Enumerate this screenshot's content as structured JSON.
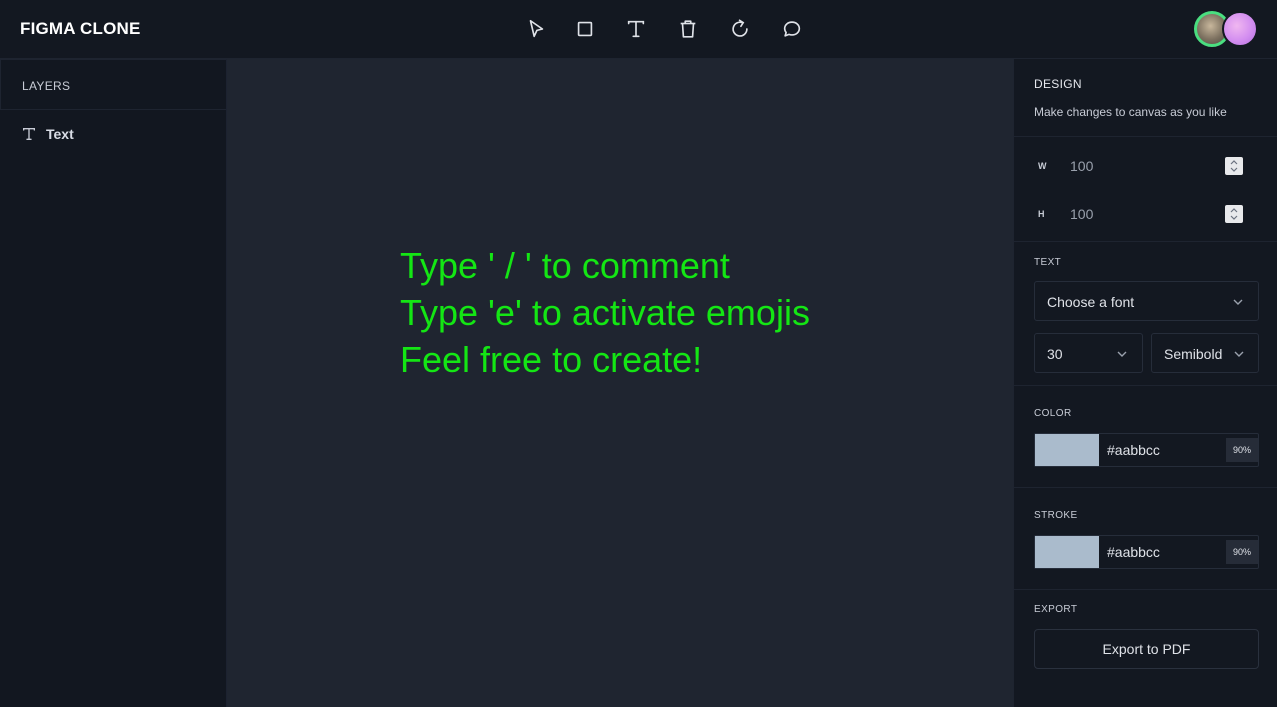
{
  "app": {
    "title": "FIGMA CLONE"
  },
  "toolbar": {
    "tools": [
      {
        "name": "select",
        "icon": "cursor-arrow-icon"
      },
      {
        "name": "rectangle",
        "icon": "square-icon"
      },
      {
        "name": "text",
        "icon": "text-t-icon"
      },
      {
        "name": "delete",
        "icon": "trash-icon"
      },
      {
        "name": "reset",
        "icon": "rotate-icon"
      },
      {
        "name": "comment",
        "icon": "chat-bubble-icon"
      }
    ]
  },
  "users": [
    {
      "icon": "avatar-photo",
      "ring_color": "#4ade80"
    },
    {
      "icon": "avatar-gradient",
      "color": "#d38ef0"
    }
  ],
  "layers": {
    "title": "LAYERS",
    "items": [
      {
        "label": "Text",
        "icon": "text-t-icon"
      }
    ]
  },
  "canvas": {
    "lines": [
      "Type ' / ' to comment",
      "Type 'e' to activate emojis",
      "Feel free to create!"
    ],
    "text_color": "#14e614"
  },
  "design": {
    "title": "DESIGN",
    "subtitle": "Make changes to canvas as you like",
    "width": {
      "label": "W",
      "value": "100"
    },
    "height": {
      "label": "H",
      "value": "100"
    }
  },
  "text_section": {
    "title": "TEXT",
    "font_family": "Choose a font",
    "font_size": "30",
    "font_weight": "Semibold"
  },
  "color_section": {
    "title": "COLOR",
    "hex": "#aabbcc",
    "opacity": "90%"
  },
  "stroke_section": {
    "title": "STROKE",
    "hex": "#aabbcc",
    "opacity": "90%"
  },
  "export_section": {
    "title": "EXPORT",
    "button_label": "Export to PDF"
  }
}
